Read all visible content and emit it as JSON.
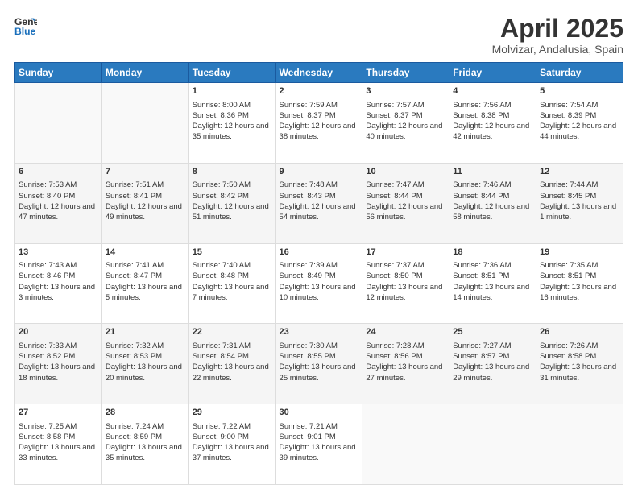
{
  "header": {
    "logo_line1": "General",
    "logo_line2": "Blue",
    "month": "April 2025",
    "location": "Molvizar, Andalusia, Spain"
  },
  "days_of_week": [
    "Sunday",
    "Monday",
    "Tuesday",
    "Wednesday",
    "Thursday",
    "Friday",
    "Saturday"
  ],
  "weeks": [
    [
      {
        "day": "",
        "sunrise": "",
        "sunset": "",
        "daylight": ""
      },
      {
        "day": "",
        "sunrise": "",
        "sunset": "",
        "daylight": ""
      },
      {
        "day": "1",
        "sunrise": "Sunrise: 8:00 AM",
        "sunset": "Sunset: 8:36 PM",
        "daylight": "Daylight: 12 hours and 35 minutes."
      },
      {
        "day": "2",
        "sunrise": "Sunrise: 7:59 AM",
        "sunset": "Sunset: 8:37 PM",
        "daylight": "Daylight: 12 hours and 38 minutes."
      },
      {
        "day": "3",
        "sunrise": "Sunrise: 7:57 AM",
        "sunset": "Sunset: 8:37 PM",
        "daylight": "Daylight: 12 hours and 40 minutes."
      },
      {
        "day": "4",
        "sunrise": "Sunrise: 7:56 AM",
        "sunset": "Sunset: 8:38 PM",
        "daylight": "Daylight: 12 hours and 42 minutes."
      },
      {
        "day": "5",
        "sunrise": "Sunrise: 7:54 AM",
        "sunset": "Sunset: 8:39 PM",
        "daylight": "Daylight: 12 hours and 44 minutes."
      }
    ],
    [
      {
        "day": "6",
        "sunrise": "Sunrise: 7:53 AM",
        "sunset": "Sunset: 8:40 PM",
        "daylight": "Daylight: 12 hours and 47 minutes."
      },
      {
        "day": "7",
        "sunrise": "Sunrise: 7:51 AM",
        "sunset": "Sunset: 8:41 PM",
        "daylight": "Daylight: 12 hours and 49 minutes."
      },
      {
        "day": "8",
        "sunrise": "Sunrise: 7:50 AM",
        "sunset": "Sunset: 8:42 PM",
        "daylight": "Daylight: 12 hours and 51 minutes."
      },
      {
        "day": "9",
        "sunrise": "Sunrise: 7:48 AM",
        "sunset": "Sunset: 8:43 PM",
        "daylight": "Daylight: 12 hours and 54 minutes."
      },
      {
        "day": "10",
        "sunrise": "Sunrise: 7:47 AM",
        "sunset": "Sunset: 8:44 PM",
        "daylight": "Daylight: 12 hours and 56 minutes."
      },
      {
        "day": "11",
        "sunrise": "Sunrise: 7:46 AM",
        "sunset": "Sunset: 8:44 PM",
        "daylight": "Daylight: 12 hours and 58 minutes."
      },
      {
        "day": "12",
        "sunrise": "Sunrise: 7:44 AM",
        "sunset": "Sunset: 8:45 PM",
        "daylight": "Daylight: 13 hours and 1 minute."
      }
    ],
    [
      {
        "day": "13",
        "sunrise": "Sunrise: 7:43 AM",
        "sunset": "Sunset: 8:46 PM",
        "daylight": "Daylight: 13 hours and 3 minutes."
      },
      {
        "day": "14",
        "sunrise": "Sunrise: 7:41 AM",
        "sunset": "Sunset: 8:47 PM",
        "daylight": "Daylight: 13 hours and 5 minutes."
      },
      {
        "day": "15",
        "sunrise": "Sunrise: 7:40 AM",
        "sunset": "Sunset: 8:48 PM",
        "daylight": "Daylight: 13 hours and 7 minutes."
      },
      {
        "day": "16",
        "sunrise": "Sunrise: 7:39 AM",
        "sunset": "Sunset: 8:49 PM",
        "daylight": "Daylight: 13 hours and 10 minutes."
      },
      {
        "day": "17",
        "sunrise": "Sunrise: 7:37 AM",
        "sunset": "Sunset: 8:50 PM",
        "daylight": "Daylight: 13 hours and 12 minutes."
      },
      {
        "day": "18",
        "sunrise": "Sunrise: 7:36 AM",
        "sunset": "Sunset: 8:51 PM",
        "daylight": "Daylight: 13 hours and 14 minutes."
      },
      {
        "day": "19",
        "sunrise": "Sunrise: 7:35 AM",
        "sunset": "Sunset: 8:51 PM",
        "daylight": "Daylight: 13 hours and 16 minutes."
      }
    ],
    [
      {
        "day": "20",
        "sunrise": "Sunrise: 7:33 AM",
        "sunset": "Sunset: 8:52 PM",
        "daylight": "Daylight: 13 hours and 18 minutes."
      },
      {
        "day": "21",
        "sunrise": "Sunrise: 7:32 AM",
        "sunset": "Sunset: 8:53 PM",
        "daylight": "Daylight: 13 hours and 20 minutes."
      },
      {
        "day": "22",
        "sunrise": "Sunrise: 7:31 AM",
        "sunset": "Sunset: 8:54 PM",
        "daylight": "Daylight: 13 hours and 22 minutes."
      },
      {
        "day": "23",
        "sunrise": "Sunrise: 7:30 AM",
        "sunset": "Sunset: 8:55 PM",
        "daylight": "Daylight: 13 hours and 25 minutes."
      },
      {
        "day": "24",
        "sunrise": "Sunrise: 7:28 AM",
        "sunset": "Sunset: 8:56 PM",
        "daylight": "Daylight: 13 hours and 27 minutes."
      },
      {
        "day": "25",
        "sunrise": "Sunrise: 7:27 AM",
        "sunset": "Sunset: 8:57 PM",
        "daylight": "Daylight: 13 hours and 29 minutes."
      },
      {
        "day": "26",
        "sunrise": "Sunrise: 7:26 AM",
        "sunset": "Sunset: 8:58 PM",
        "daylight": "Daylight: 13 hours and 31 minutes."
      }
    ],
    [
      {
        "day": "27",
        "sunrise": "Sunrise: 7:25 AM",
        "sunset": "Sunset: 8:58 PM",
        "daylight": "Daylight: 13 hours and 33 minutes."
      },
      {
        "day": "28",
        "sunrise": "Sunrise: 7:24 AM",
        "sunset": "Sunset: 8:59 PM",
        "daylight": "Daylight: 13 hours and 35 minutes."
      },
      {
        "day": "29",
        "sunrise": "Sunrise: 7:22 AM",
        "sunset": "Sunset: 9:00 PM",
        "daylight": "Daylight: 13 hours and 37 minutes."
      },
      {
        "day": "30",
        "sunrise": "Sunrise: 7:21 AM",
        "sunset": "Sunset: 9:01 PM",
        "daylight": "Daylight: 13 hours and 39 minutes."
      },
      {
        "day": "",
        "sunrise": "",
        "sunset": "",
        "daylight": ""
      },
      {
        "day": "",
        "sunrise": "",
        "sunset": "",
        "daylight": ""
      },
      {
        "day": "",
        "sunrise": "",
        "sunset": "",
        "daylight": ""
      }
    ]
  ]
}
